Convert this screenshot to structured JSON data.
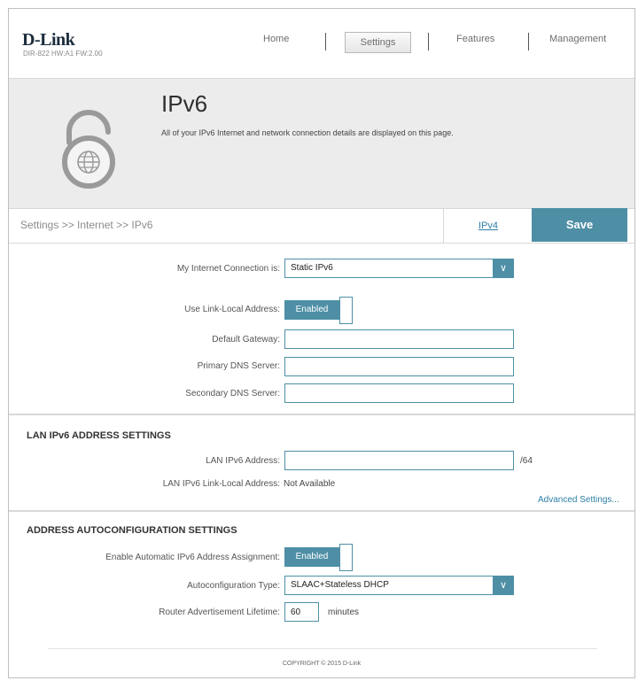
{
  "header": {
    "logo": "D-Link",
    "model": "DIR-822 HW:A1 FW:2.00",
    "nav": {
      "home": "Home",
      "settings": "Settings",
      "features": "Features",
      "management": "Management"
    }
  },
  "hero": {
    "title": "IPv6",
    "description": "All of your IPv6 Internet and network connection details are displayed on this page."
  },
  "breadcrumb": "Settings >> Internet >> IPv6",
  "tabs": {
    "ipv4": "IPv4",
    "save": "Save"
  },
  "connection": {
    "label": "My Internet Connection is:",
    "value": "Static IPv6"
  },
  "link_local": {
    "label": "Use Link-Local Address:",
    "state": "Enabled"
  },
  "default_gateway": {
    "label": "Default Gateway:",
    "value": ""
  },
  "primary_dns": {
    "label": "Primary DNS Server:",
    "value": ""
  },
  "secondary_dns": {
    "label": "Secondary DNS Server:",
    "value": ""
  },
  "lan": {
    "title": "LAN IPv6 ADDRESS SETTINGS",
    "address_label": "LAN IPv6 Address:",
    "address_value": "",
    "prefix": "/64",
    "link_local_label": "LAN IPv6 Link-Local Address:",
    "link_local_value": "Not Available",
    "advanced": "Advanced Settings..."
  },
  "autoconfig": {
    "title": "ADDRESS AUTOCONFIGURATION SETTINGS",
    "enable_label": "Enable Automatic IPv6 Address Assignment:",
    "enable_state": "Enabled",
    "type_label": "Autoconfiguration Type:",
    "type_value": "SLAAC+Stateless DHCP",
    "lifetime_label": "Router Advertisement Lifetime:",
    "lifetime_value": "60",
    "lifetime_unit": "minutes"
  },
  "footer": "COPYRIGHT © 2015 D-Link",
  "colors": {
    "accent": "#4e8fa6",
    "link": "#2d7fa6",
    "hero_bg": "#ececec"
  }
}
